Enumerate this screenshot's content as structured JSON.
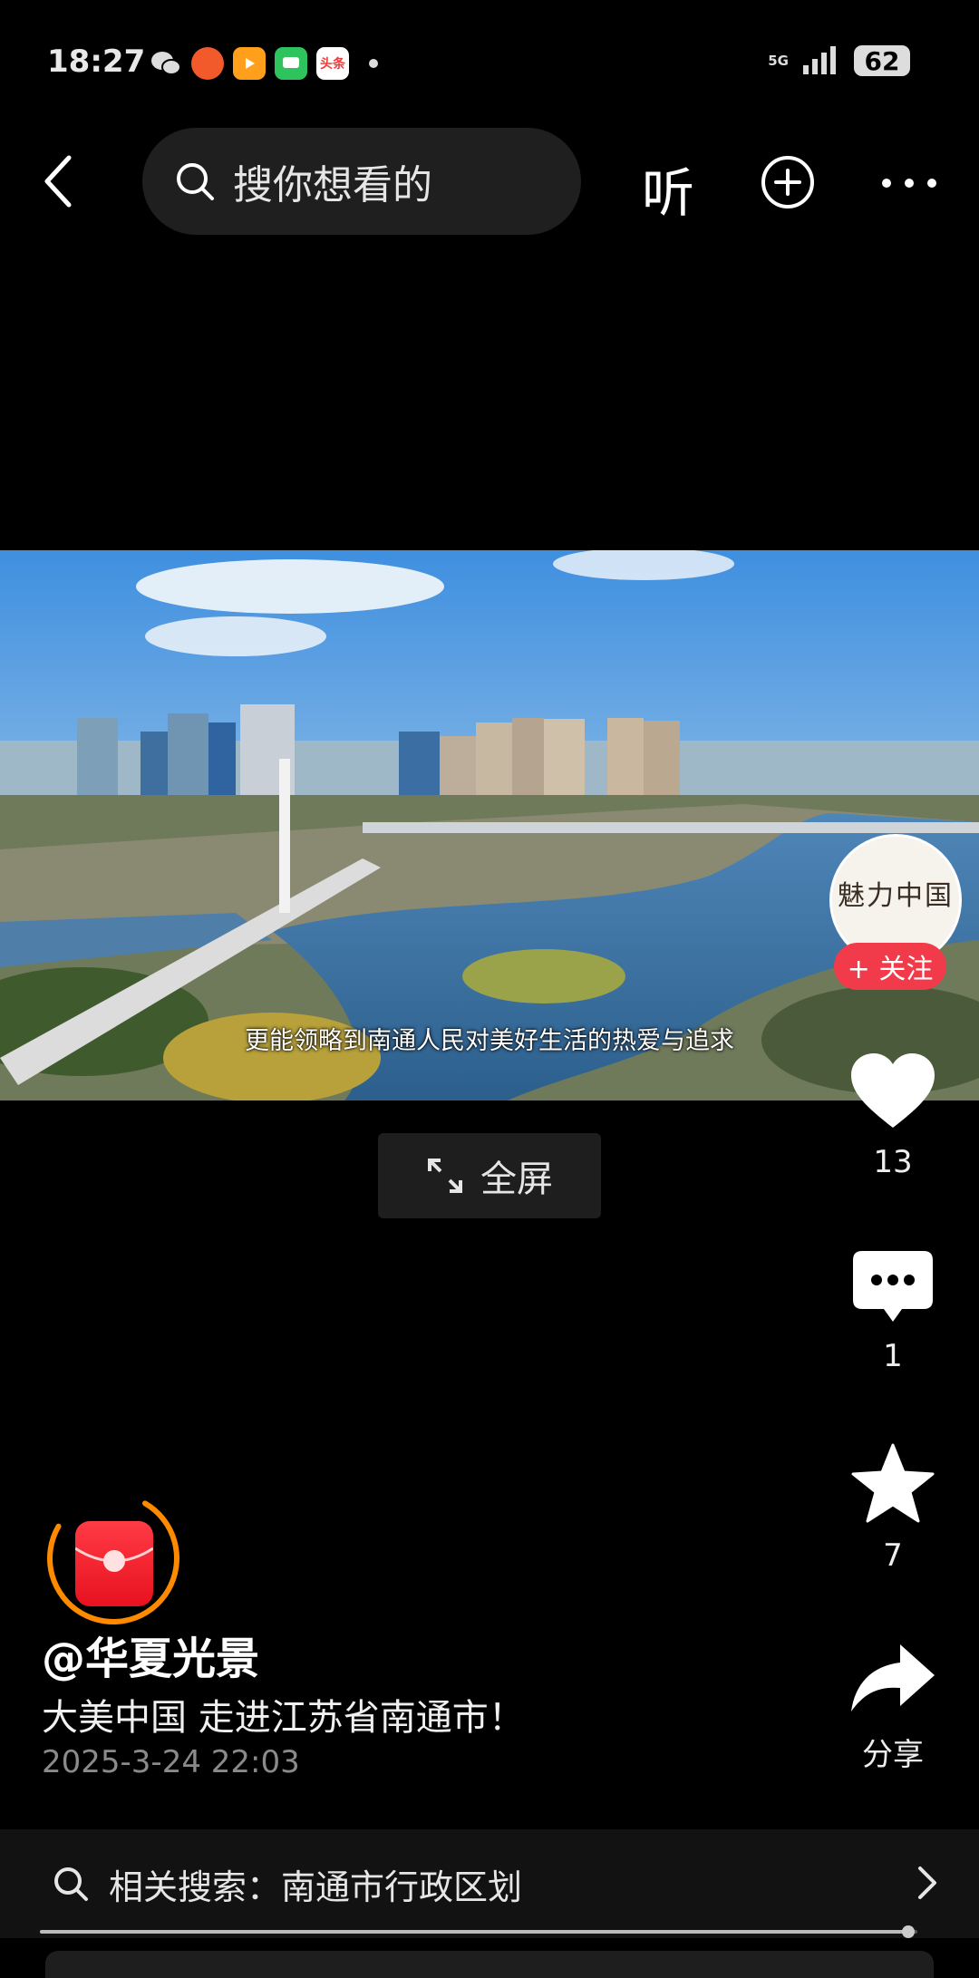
{
  "status_bar": {
    "time": "18:27",
    "network": "5G",
    "battery": "62",
    "notification_apps": [
      {
        "icon": "wechat-icon",
        "color": "#ffffff"
      },
      {
        "icon": "taobao-icon",
        "color": "#f25a2c"
      },
      {
        "icon": "video-app-icon",
        "color": "#ff9f1c"
      },
      {
        "icon": "messages-icon",
        "color": "#2fc35e"
      },
      {
        "icon": "toutiao-icon",
        "color": "#f23b3b",
        "label": "头条"
      }
    ]
  },
  "top_nav": {
    "search_placeholder": "搜你想看的",
    "listen_label": "听"
  },
  "video": {
    "subtitle": "更能领略到南通人民对美好生活的热爱与追求",
    "fullscreen_label": "全屏"
  },
  "creator": {
    "avatar_text": "魅力中国",
    "follow_label": "+ 关注"
  },
  "actions": {
    "likes": "13",
    "comments": "1",
    "favorites": "7",
    "share_label": "分享"
  },
  "post": {
    "author": "@华夏光景",
    "title": "大美中国 走进江苏省南通市！",
    "date": "2025-3-24 22:03"
  },
  "related_search": {
    "text": "相关搜索：南通市行政区划"
  },
  "progress": {
    "played_fraction": 0.99
  },
  "colors": {
    "accent_red": "#f23b4a",
    "background": "#000000",
    "redpack_ring": "#ff8a00"
  }
}
